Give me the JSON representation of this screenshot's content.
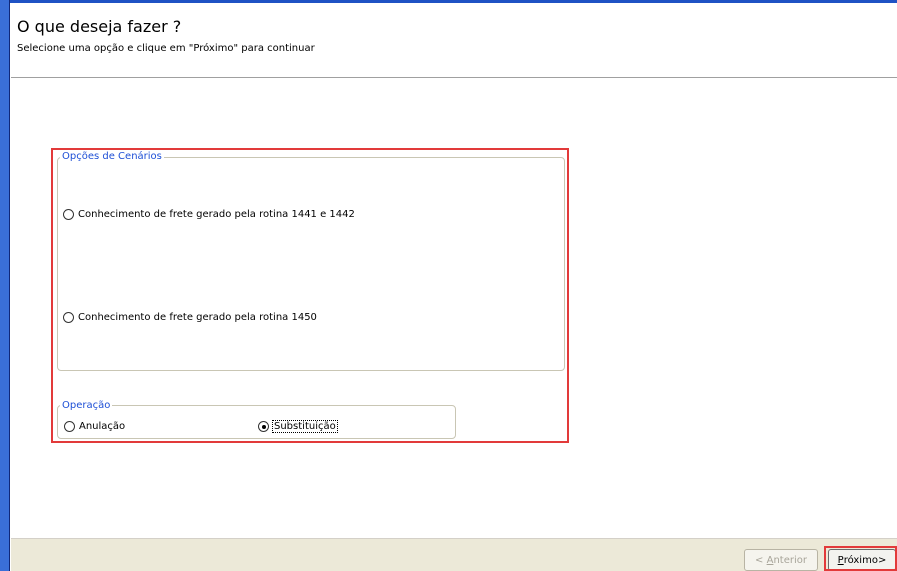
{
  "header": {
    "title": "O que deseja fazer ?",
    "subtitle": "Selecione uma opção e clique em \"Próximo\" para continuar"
  },
  "cenarios": {
    "legend": "Opções de Cenários",
    "options": [
      {
        "label": "Conhecimento de frete gerado pela rotina 1441 e 1442",
        "checked": false
      },
      {
        "label": "Conhecimento de frete gerado pela rotina 1450",
        "checked": false
      }
    ]
  },
  "operacao": {
    "legend": "Operação",
    "options": [
      {
        "label": "Anulação",
        "checked": false
      },
      {
        "label": "Substituição",
        "checked": true
      }
    ]
  },
  "footer": {
    "anterior_prefix": "< ",
    "anterior_access": "A",
    "anterior_rest": "nterior",
    "proximo_access": "P",
    "proximo_rest": "róximo>"
  },
  "colors": {
    "highlight": "#e23a3a",
    "legend_text": "#1d4fd6",
    "footer_bg": "#ece9d8"
  }
}
